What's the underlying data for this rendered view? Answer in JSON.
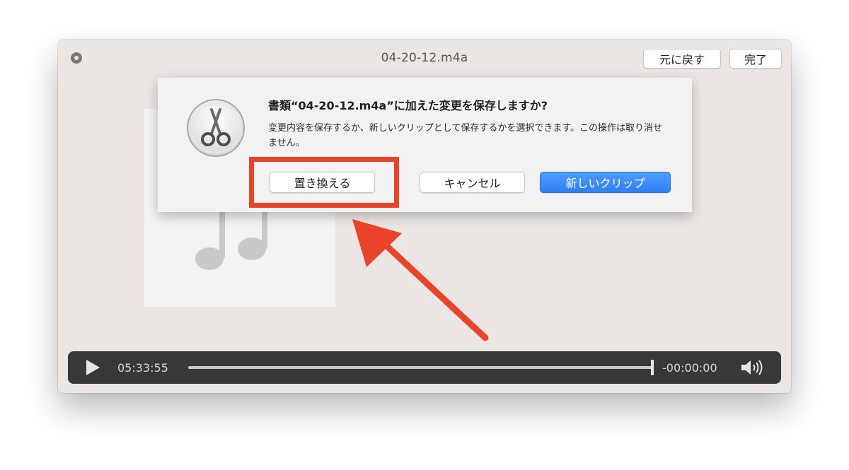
{
  "window": {
    "title": "04-20-12.m4a",
    "revert_label": "元に戻す",
    "done_label": "完了"
  },
  "dialog": {
    "title": "書類“04-20-12.m4a”に加えた変更を保存しますか?",
    "message": "変更内容を保存するか、新しいクリップとして保存するかを選択できます。この操作は取り消せません。",
    "replace_label": "置き換える",
    "cancel_label": "キャンセル",
    "new_clip_label": "新しいクリップ",
    "icon": "scissors-icon"
  },
  "player": {
    "elapsed": "05:33:55",
    "remaining": "-00:00:00",
    "progress": 1.0
  },
  "annotation": {
    "color": "#e94329"
  },
  "colors": {
    "accent": "#2f80f4",
    "controls_bg": "#383838",
    "window_bg": "#ebe5e4"
  }
}
